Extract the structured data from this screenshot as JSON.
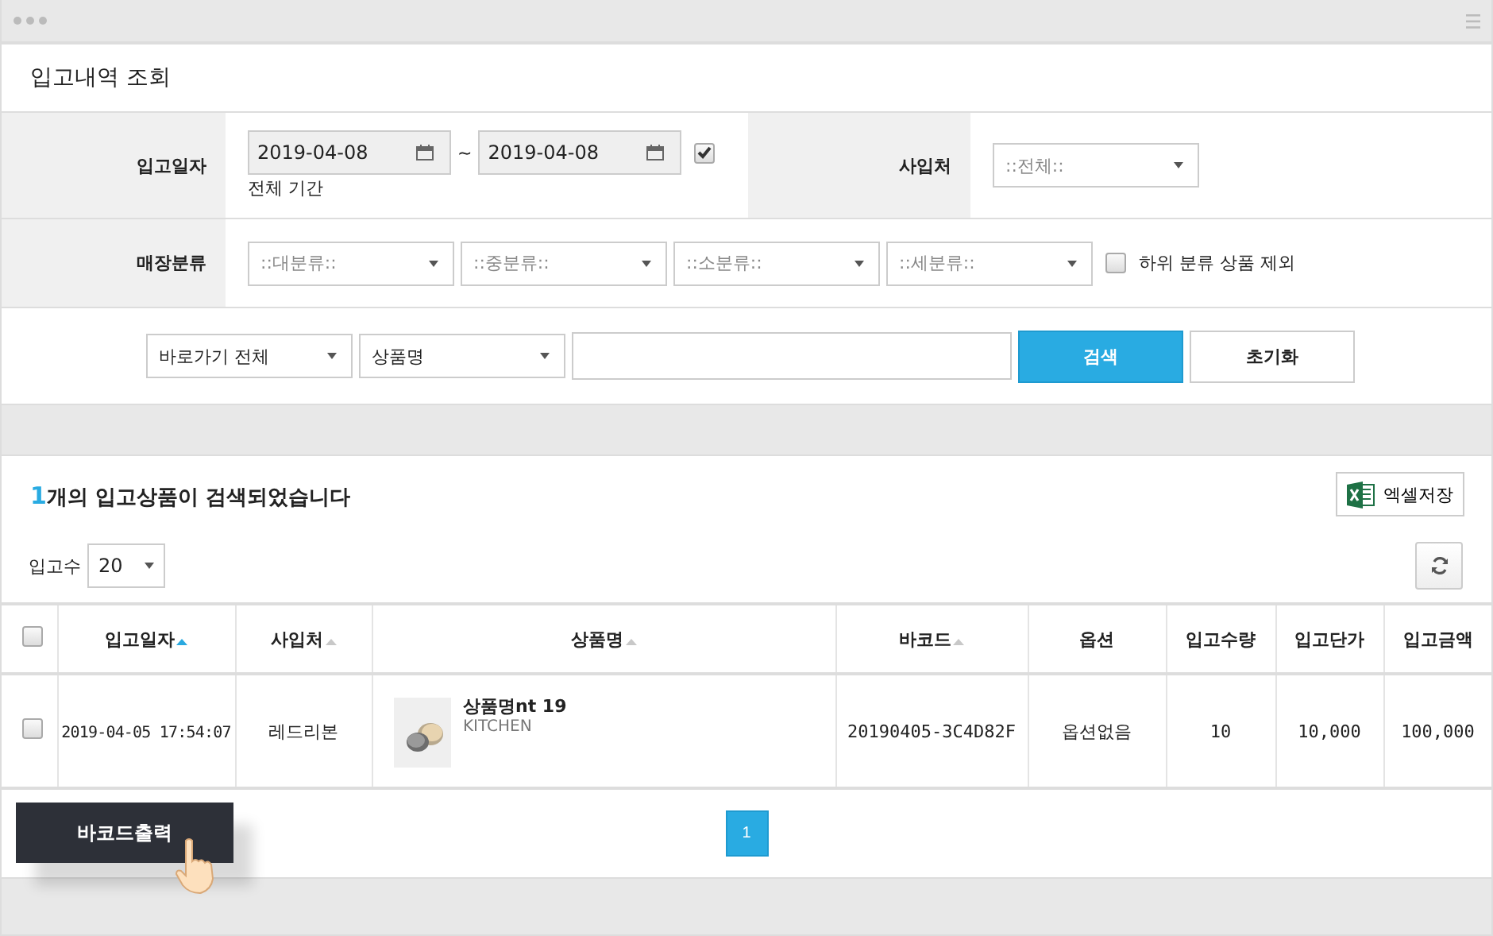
{
  "window": {
    "title": "입고내역 조회"
  },
  "filters": {
    "date_label": "입고일자",
    "date_from": "2019-04-08",
    "range_separator": "~",
    "date_to": "2019-04-08",
    "all_period": {
      "label": "전체 기간",
      "checked": true
    },
    "supplier_label": "사입처",
    "supplier_value": "::전체::",
    "category_label": "매장분류",
    "categories": [
      "::대분류::",
      "::중분류::",
      "::소분류::",
      "::세분류::"
    ],
    "exclude_sub": {
      "label": "하위 분류 상품 제외",
      "checked": false
    }
  },
  "search": {
    "shortcut": "바로가기 전체",
    "field": "상품명",
    "buttons": [
      {
        "label": "검색",
        "kind": "primary"
      },
      {
        "label": "초기화",
        "kind": "plain"
      }
    ]
  },
  "results": {
    "count": "1",
    "message": "개의 입고상품이 검색되었습니다",
    "excel_button": "엑셀저장",
    "per_page_label": "입고수",
    "per_page": "20"
  },
  "table": {
    "header_checked": false,
    "columns": [
      {
        "label": "입고일자",
        "sortable": true,
        "sorted": true
      },
      {
        "label": "사입처",
        "sortable": true,
        "sorted": false
      },
      {
        "label": "상품명",
        "sortable": true,
        "sorted": false
      },
      {
        "label": "바코드",
        "sortable": true,
        "sorted": false
      },
      {
        "label": "옵션",
        "sortable": false,
        "sorted": false
      },
      {
        "label": "입고수량",
        "sortable": false,
        "sorted": false
      },
      {
        "label": "입고단가",
        "sortable": false,
        "sorted": false
      },
      {
        "label": "입고금액",
        "sortable": false,
        "sorted": false
      }
    ],
    "rows": [
      {
        "checked": false,
        "date": "2019-04-05 17:54:07",
        "supplier": "레드리본",
        "product": {
          "kind": "picture",
          "name": "상품명nt 19",
          "brand": "KITCHEN"
        },
        "barcode": "20190405-3C4D82F",
        "option": "옵션없음",
        "quantity": "10",
        "unit_price": "10,000",
        "amount": "100,000"
      }
    ]
  },
  "footer": {
    "barcode_button": "바코드출력",
    "pages": [
      {
        "label": "1",
        "selected": true
      }
    ]
  }
}
